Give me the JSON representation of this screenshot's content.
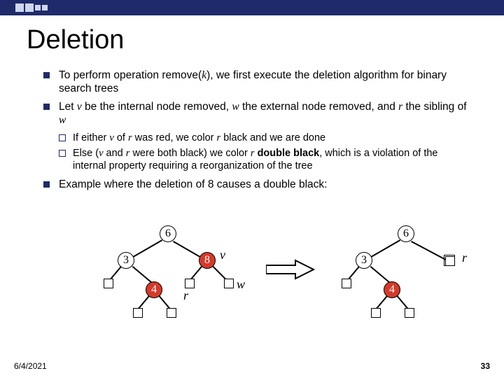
{
  "title": "Deletion",
  "bullets": {
    "b1": "To perform operation remove",
    "b1_param": "k",
    "b1_tail": ", we first execute the deletion algorithm for binary search trees",
    "b2_a": "Let ",
    "b2_v": "v",
    "b2_b": " be the internal node removed, ",
    "b2_w": "w",
    "b2_c": " the external node removed, and ",
    "b2_r": "r",
    "b2_d": " the sibling of ",
    "b2_w2": "w",
    "sub1_a": "If either ",
    "sub1_v": "v",
    "sub1_b": " of ",
    "sub1_r": "r",
    "sub1_c": " was red, we color ",
    "sub1_r2": "r",
    "sub1_d": " black and we are done",
    "sub2_a": "Else (",
    "sub2_v": "v",
    "sub2_b": " and ",
    "sub2_r": "r",
    "sub2_c": " were both black) we color ",
    "sub2_r2": "r",
    "sub2_d1": " ",
    "sub2_db": "double black",
    "sub2_e": ", which is a violation of the internal property requiring a reorganization of the tree",
    "b3": "Example where the deletion of  8 causes a double black:"
  },
  "labels": {
    "v": "v",
    "r": "r",
    "w": "w"
  },
  "nodes": {
    "six": "6",
    "three": "3",
    "eight": "8",
    "four": "4"
  },
  "footer_date": "6/4/2021",
  "page_num": "33"
}
